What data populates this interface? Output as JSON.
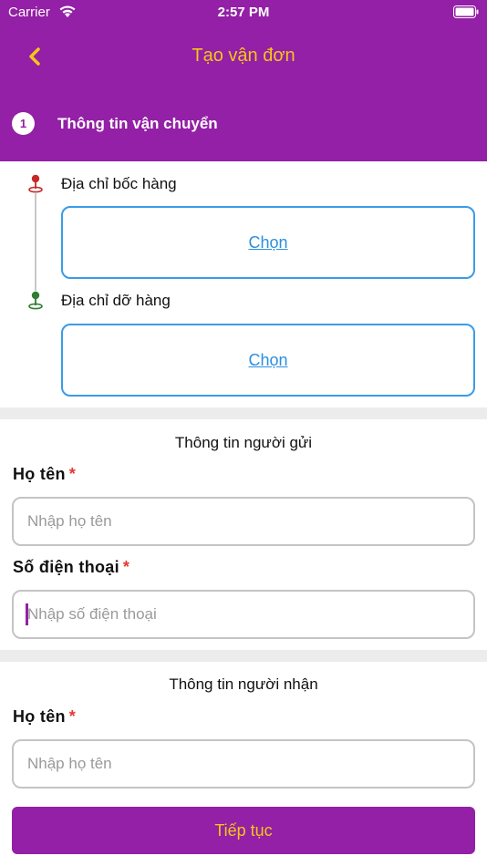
{
  "status_bar": {
    "carrier": "Carrier",
    "time": "2:57 PM"
  },
  "header": {
    "title": "Tạo vận đơn",
    "back_icon": "chevron-left-icon"
  },
  "step": {
    "number": "1",
    "label": "Thông tin vận chuyển"
  },
  "pickup": {
    "label": "Địa chỉ bốc hàng",
    "action": "Chọn",
    "pin_color": "#c62828"
  },
  "dropoff": {
    "label": "Địa chỉ dỡ hàng",
    "action": "Chọn",
    "pin_color": "#2e7d32"
  },
  "sender": {
    "title": "Thông tin người gửi",
    "name_label": "Họ tên",
    "name_placeholder": "Nhập họ tên",
    "phone_label": "Số điện thoại",
    "phone_placeholder": "Nhập số điện thoại",
    "required_mark": "*"
  },
  "receiver": {
    "title": "Thông tin người nhận",
    "name_label": "Họ tên",
    "name_placeholder": "Nhập họ tên",
    "required_mark": "*"
  },
  "continue_label": "Tiếp tục",
  "colors": {
    "brand": "#9320a6",
    "accent": "#f5c518",
    "link": "#2b8fe0",
    "required": "#e53935"
  }
}
